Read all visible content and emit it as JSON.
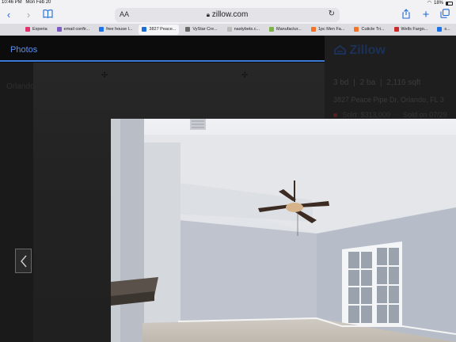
{
  "status_bar": {
    "time": "10:46 PM",
    "date": "Mon Feb 20",
    "battery": "18%"
  },
  "browser": {
    "text_size_label": "AA",
    "url": "zillow.com",
    "icons": [
      "back-icon",
      "forward-icon",
      "bookmarks-icon",
      "text-size-icon",
      "lock-icon",
      "reload-icon",
      "share-icon",
      "new-tab-icon",
      "tabs-icon"
    ]
  },
  "tabs": [
    {
      "label": "Experia",
      "color": "#e1306c"
    },
    {
      "label": "email confir...",
      "color": "#7b5cc4"
    },
    {
      "label": "free house l...",
      "color": "#1a73e8"
    },
    {
      "label": "3827 Peace...",
      "color": "#1b6ed6",
      "active": true
    },
    {
      "label": "VyStar Cre...",
      "color": "#6a6a6a"
    },
    {
      "label": "nastybets.c...",
      "color": "#bbbbbb"
    },
    {
      "label": "Manufactur...",
      "color": "#7db246"
    },
    {
      "label": "1pc Men Fa...",
      "color": "#f57224"
    },
    {
      "label": "Cuticle Tri...",
      "color": "#f57224"
    },
    {
      "label": "Wells Fargo...",
      "color": "#cc2a2a"
    },
    {
      "label": "s...",
      "color": "#1a73e8"
    }
  ],
  "page": {
    "photos_tab": "Photos",
    "city_partial": "Orlando",
    "brand": "Zillow",
    "beds": "3 bd",
    "baths": "2 ba",
    "sqft": "2,116 sqft",
    "address": "3827 Peace Pipe Dr, Orlando, FL 3",
    "sold_price": "Sold: $313,000",
    "sold_date": "Sold on 07/29"
  },
  "colors": {
    "accent": "#3d7bd9",
    "wall": "#bcc1cc",
    "ceiling": "#e8e9ec"
  }
}
